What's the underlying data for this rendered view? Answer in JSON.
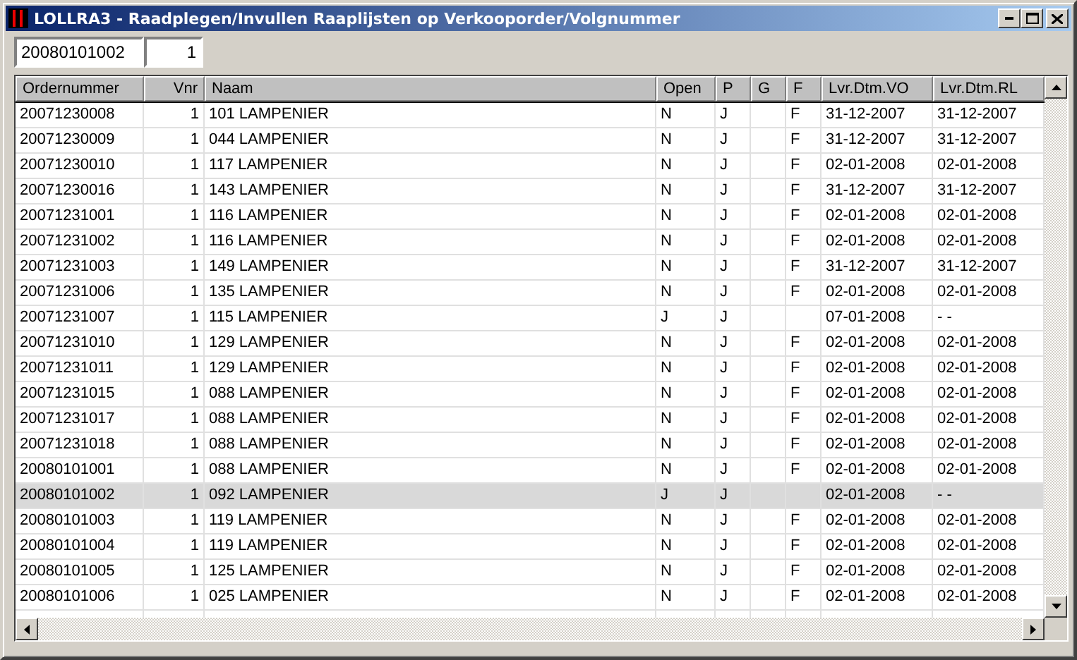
{
  "window": {
    "title": "LOLLRA3 - Raadplegen/Invullen Raaplijsten op Verkooporder/Volgnummer"
  },
  "fields": [
    {
      "value": "20080101002"
    },
    {
      "value": "1"
    }
  ],
  "table": {
    "columns": [
      "Ordernummer",
      "Vnr",
      "Naam",
      "Open",
      "P",
      "G",
      "F",
      "Lvr.Dtm.VO",
      "Lvr.Dtm.RL"
    ],
    "rows": [
      {
        "selected": false,
        "cells": [
          "20071230008",
          "1",
          "101 LAMPENIER",
          "N",
          "J",
          null,
          "F",
          "31-12-2007",
          "31-12-2007"
        ]
      },
      {
        "selected": false,
        "cells": [
          "20071230009",
          "1",
          "044 LAMPENIER",
          "N",
          "J",
          null,
          "F",
          "31-12-2007",
          "31-12-2007"
        ]
      },
      {
        "selected": false,
        "cells": [
          "20071230010",
          "1",
          "117 LAMPENIER",
          "N",
          "J",
          null,
          "F",
          "02-01-2008",
          "02-01-2008"
        ]
      },
      {
        "selected": false,
        "cells": [
          "20071230016",
          "1",
          "143 LAMPENIER",
          "N",
          "J",
          null,
          "F",
          "31-12-2007",
          "31-12-2007"
        ]
      },
      {
        "selected": false,
        "cells": [
          "20071231001",
          "1",
          "116 LAMPENIER",
          "N",
          "J",
          null,
          "F",
          "02-01-2008",
          "02-01-2008"
        ]
      },
      {
        "selected": false,
        "cells": [
          "20071231002",
          "1",
          "116 LAMPENIER",
          "N",
          "J",
          null,
          "F",
          "02-01-2008",
          "02-01-2008"
        ]
      },
      {
        "selected": false,
        "cells": [
          "20071231003",
          "1",
          "149 LAMPENIER",
          "N",
          "J",
          null,
          "F",
          "31-12-2007",
          "31-12-2007"
        ]
      },
      {
        "selected": false,
        "cells": [
          "20071231006",
          "1",
          "135 LAMPENIER",
          "N",
          "J",
          null,
          "F",
          "02-01-2008",
          "02-01-2008"
        ]
      },
      {
        "selected": false,
        "cells": [
          "20071231007",
          "1",
          "115 LAMPENIER",
          "J",
          "J",
          null,
          null,
          "07-01-2008",
          "- -"
        ]
      },
      {
        "selected": false,
        "cells": [
          "20071231010",
          "1",
          "129 LAMPENIER",
          "N",
          "J",
          null,
          "F",
          "02-01-2008",
          "02-01-2008"
        ]
      },
      {
        "selected": false,
        "cells": [
          "20071231011",
          "1",
          "129 LAMPENIER",
          "N",
          "J",
          null,
          "F",
          "02-01-2008",
          "02-01-2008"
        ]
      },
      {
        "selected": false,
        "cells": [
          "20071231015",
          "1",
          "088 LAMPENIER",
          "N",
          "J",
          null,
          "F",
          "02-01-2008",
          "02-01-2008"
        ]
      },
      {
        "selected": false,
        "cells": [
          "20071231017",
          "1",
          "088 LAMPENIER",
          "N",
          "J",
          null,
          "F",
          "02-01-2008",
          "02-01-2008"
        ]
      },
      {
        "selected": false,
        "cells": [
          "20071231018",
          "1",
          "088 LAMPENIER",
          "N",
          "J",
          null,
          "F",
          "02-01-2008",
          "02-01-2008"
        ]
      },
      {
        "selected": false,
        "cells": [
          "20080101001",
          "1",
          "088 LAMPENIER",
          "N",
          "J",
          null,
          "F",
          "02-01-2008",
          "02-01-2008"
        ]
      },
      {
        "selected": true,
        "cells": [
          "20080101002",
          "1",
          "092 LAMPENIER",
          "J",
          "J",
          null,
          null,
          "02-01-2008",
          "- -"
        ]
      },
      {
        "selected": false,
        "cells": [
          "20080101003",
          "1",
          "119 LAMPENIER",
          "N",
          "J",
          null,
          "F",
          "02-01-2008",
          "02-01-2008"
        ]
      },
      {
        "selected": false,
        "cells": [
          "20080101004",
          "1",
          "119 LAMPENIER",
          "N",
          "J",
          null,
          "F",
          "02-01-2008",
          "02-01-2008"
        ]
      },
      {
        "selected": false,
        "cells": [
          "20080101005",
          "1",
          "125 LAMPENIER",
          "N",
          "J",
          null,
          "F",
          "02-01-2008",
          "02-01-2008"
        ]
      },
      {
        "selected": false,
        "cells": [
          "20080101006",
          "1",
          "025 LAMPENIER",
          "N",
          "J",
          null,
          "F",
          "02-01-2008",
          "02-01-2008"
        ]
      }
    ]
  }
}
